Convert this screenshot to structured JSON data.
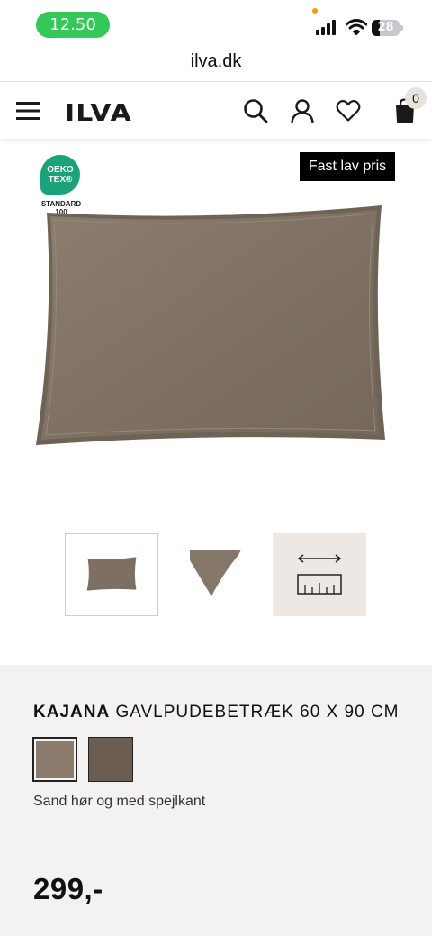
{
  "status": {
    "time": "12.50",
    "battery": "28"
  },
  "browser": {
    "url": "ilva.dk"
  },
  "header": {
    "logo": "ILVA",
    "cart_count": "0"
  },
  "badges": {
    "oeko_line1": "OEKO",
    "oeko_line2": "TEX®",
    "oeko_std_line1": "STANDARD",
    "oeko_std_line2": "100",
    "price_tag": "Fast lav pris"
  },
  "product": {
    "brand": "KAJANA",
    "name": "GAVLPUDEBETRÆK 60 X 90 CM",
    "color_name": "Sand hør og med spejlkant",
    "price": "299,-",
    "swatches": [
      "#8a7b6c",
      "#6b5d51"
    ]
  }
}
